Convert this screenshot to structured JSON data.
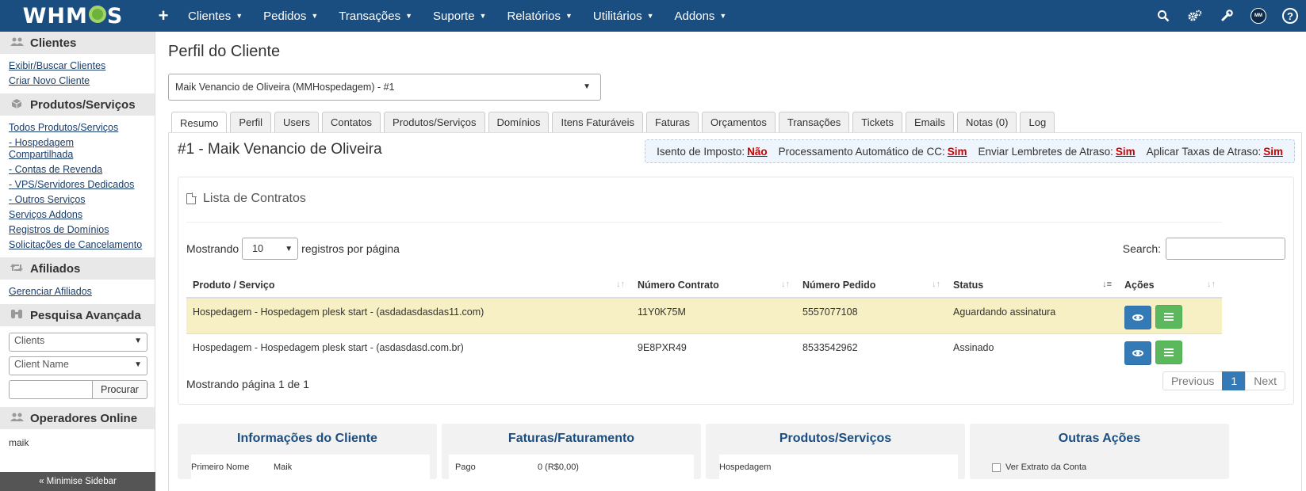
{
  "topbar": {
    "logo_text_left": "WHM",
    "logo_text_right": "S",
    "add_label": "+",
    "menu": [
      {
        "label": "Clientes"
      },
      {
        "label": "Pedidos"
      },
      {
        "label": "Transações"
      },
      {
        "label": "Suporte"
      },
      {
        "label": "Relatórios"
      },
      {
        "label": "Utilitários"
      },
      {
        "label": "Addons"
      }
    ],
    "avatar_text": "MM",
    "help_text": "?"
  },
  "sidebar": {
    "clientes": {
      "title": "Clientes",
      "links": [
        "Exibir/Buscar Clientes",
        "Criar Novo Cliente"
      ]
    },
    "produtos": {
      "title": "Produtos/Serviços",
      "links": [
        "Todos Produtos/Serviços",
        "- Hospedagem Compartilhada",
        "- Contas de Revenda",
        "- VPS/Servidores Dedicados",
        "- Outros Serviços",
        "Serviços Addons",
        "Registros de Domínios",
        "Solicitações de Cancelamento"
      ]
    },
    "afiliados": {
      "title": "Afiliados",
      "links": [
        "Gerenciar Afiliados"
      ]
    },
    "pesquisa": {
      "title": "Pesquisa Avançada",
      "type_value": "Clients",
      "field_value": "Client Name",
      "button": "Procurar"
    },
    "online": {
      "title": "Operadores Online",
      "user": "maik"
    },
    "minimise": "« Minimise Sidebar"
  },
  "main": {
    "page_title": "Perfil do Cliente",
    "client_select": "Maik Venancio de Oliveira (MMHospedagem) - #1",
    "tabs": [
      {
        "label": "Resumo"
      },
      {
        "label": "Perfil"
      },
      {
        "label": "Users"
      },
      {
        "label": "Contatos"
      },
      {
        "label": "Produtos/Serviços"
      },
      {
        "label": "Domínios"
      },
      {
        "label": "Itens Faturáveis"
      },
      {
        "label": "Faturas"
      },
      {
        "label": "Orçamentos"
      },
      {
        "label": "Transações"
      },
      {
        "label": "Tickets"
      },
      {
        "label": "Emails"
      },
      {
        "label": "Notas (0)"
      },
      {
        "label": "Log"
      }
    ],
    "client_heading": "#1 - Maik Venancio de Oliveira",
    "flags": [
      {
        "label": "Isento de Imposto:",
        "value": "Não"
      },
      {
        "label": "Processamento Automático de CC:",
        "value": "Sim"
      },
      {
        "label": "Enviar Lembretes de Atraso:",
        "value": "Sim"
      },
      {
        "label": "Aplicar Taxas de Atraso:",
        "value": "Sim"
      }
    ]
  },
  "contracts": {
    "title": "Lista de Contratos",
    "length_prefix": "Mostrando",
    "length_value": "10",
    "length_suffix": "registros por página",
    "search_label": "Search:",
    "columns": [
      "Produto / Serviço",
      "Número Contrato",
      "Número Pedido",
      "Status",
      "Ações"
    ],
    "rows": [
      {
        "produto": "Hospedagem - Hospedagem plesk start - (asdadasdasdas11.com)",
        "contrato": "11Y0K75M",
        "pedido": "5557077108",
        "status": "Aguardando assinatura"
      },
      {
        "produto": "Hospedagem - Hospedagem plesk start - (asdasdasd.com.br)",
        "contrato": "9E8PXR49",
        "pedido": "8533542962",
        "status": "Assinado"
      }
    ],
    "info": "Mostrando página 1 de 1",
    "pager": {
      "prev": "Previous",
      "current": "1",
      "next": "Next"
    }
  },
  "cards": [
    {
      "title": "Informações do Cliente",
      "first_key": "Primeiro Nome",
      "first_val": "Maik"
    },
    {
      "title": "Faturas/Faturamento",
      "first_key": "Pago",
      "first_val": "0 (R$0,00)"
    },
    {
      "title": "Produtos/Serviços",
      "first_key": "Hospedagem",
      "first_val": ""
    },
    {
      "title": "Outras Ações",
      "first_key": "Ver Extrato da Conta",
      "first_val": ""
    }
  ]
}
